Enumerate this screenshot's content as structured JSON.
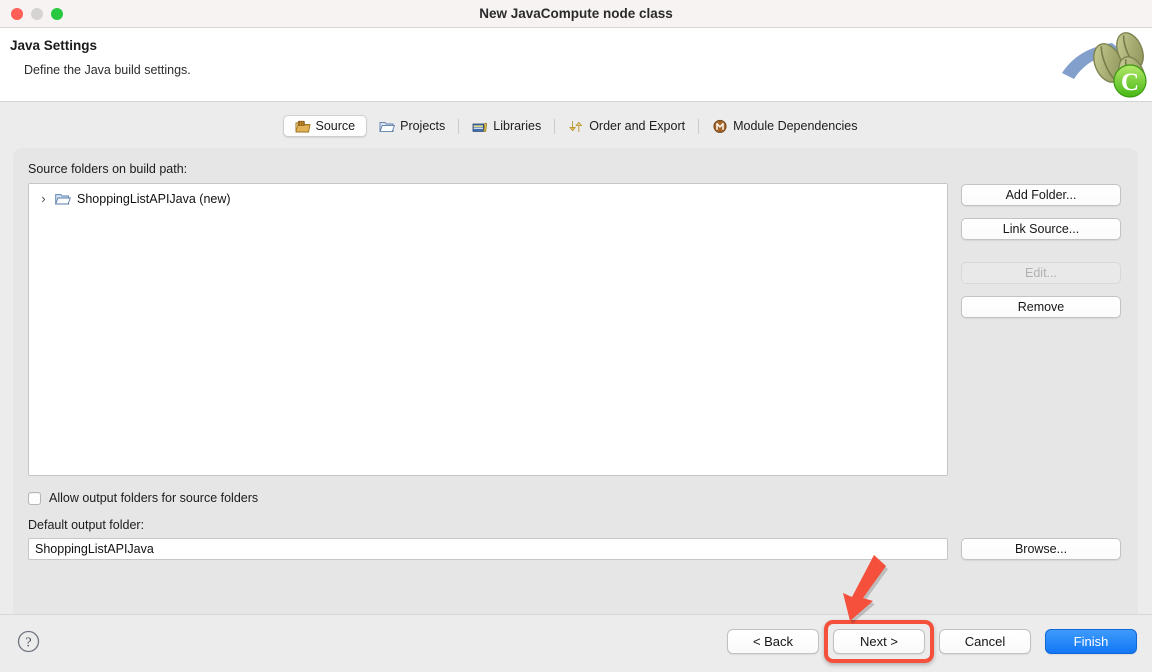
{
  "window": {
    "title": "New JavaCompute node class",
    "traffic_lights": [
      "close",
      "minimize",
      "zoom"
    ]
  },
  "header": {
    "title": "Java Settings",
    "subtitle": "Define the Java build settings.",
    "logo_icon": "java-coffee-beans-logo"
  },
  "tabs": [
    {
      "label": "Source",
      "icon": "source-folder-icon",
      "selected": true
    },
    {
      "label": "Projects",
      "icon": "open-folder-icon",
      "selected": false
    },
    {
      "label": "Libraries",
      "icon": "books-icon",
      "selected": false
    },
    {
      "label": "Order and Export",
      "icon": "up-down-arrows-icon",
      "selected": false
    },
    {
      "label": "Module Dependencies",
      "icon": "module-circle-icon",
      "selected": false
    }
  ],
  "source_tab": {
    "tree_label": "Source folders on build path:",
    "tree_items": [
      {
        "label": "ShoppingListAPIJava (new)",
        "icon": "folder-icon",
        "expander": "›"
      }
    ],
    "buttons": [
      {
        "label": "Add Folder...",
        "enabled": true
      },
      {
        "label": "Link Source...",
        "enabled": true
      },
      {
        "label": "Edit...",
        "enabled": false
      },
      {
        "label": "Remove",
        "enabled": true
      }
    ],
    "allow_output_checkbox": {
      "label": "Allow output folders for source folders",
      "checked": false
    },
    "default_output_label": "Default output folder:",
    "default_output_value": "ShoppingListAPIJava",
    "browse_label": "Browse..."
  },
  "footer": {
    "help_icon": "question-mark-icon",
    "buttons": [
      {
        "label": "< Back",
        "primary": false,
        "highlighted": false
      },
      {
        "label": "Next >",
        "primary": false,
        "highlighted": true
      },
      {
        "label": "Cancel",
        "primary": false,
        "highlighted": false
      },
      {
        "label": "Finish",
        "primary": true,
        "highlighted": false
      }
    ]
  },
  "annotations": {
    "arrow": {
      "icon": "red-down-arrow",
      "color": "#f4503c",
      "points_to": "Next >"
    },
    "highlight_color": "#f4503c"
  },
  "colors": {
    "accent_blue": "#1277f5",
    "annotation_red": "#f4503c",
    "window_bg": "#ececec",
    "panel_bg": "#e6e6e6",
    "field_bg": "#ffffff"
  }
}
